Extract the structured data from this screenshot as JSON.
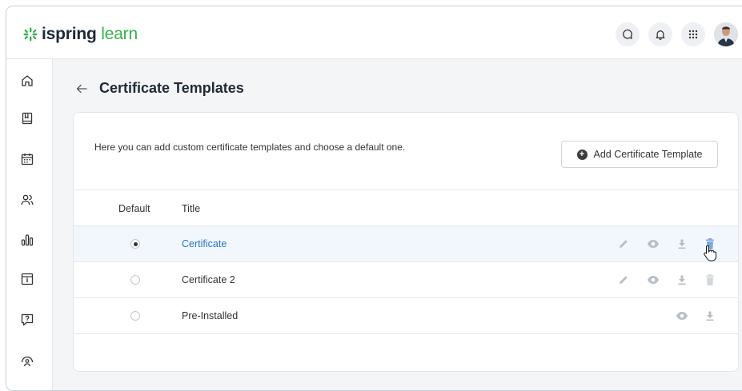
{
  "app": {
    "logo_bold": "ispring",
    "logo_light": " learn",
    "brand_color": "#35b34a"
  },
  "topbar": {
    "icons": [
      "chat-icon",
      "bell-icon",
      "apps-grid-icon"
    ],
    "avatar": "user-avatar"
  },
  "sidebar": {
    "items": [
      {
        "name": "home-icon"
      },
      {
        "name": "book-icon"
      },
      {
        "name": "calendar-icon"
      },
      {
        "name": "people-icon"
      },
      {
        "name": "reports-icon"
      },
      {
        "name": "catalog-icon"
      },
      {
        "name": "help-icon"
      },
      {
        "name": "admin-icon"
      }
    ]
  },
  "page": {
    "title": "Certificate Templates",
    "intro": "Here you can add custom certificate templates and choose a default one.",
    "add_button": "Add Certificate Template"
  },
  "table": {
    "columns": [
      "Default",
      "Title"
    ],
    "rows": [
      {
        "title": "Certificate",
        "default": true,
        "actions": [
          "edit-icon",
          "preview-icon",
          "download-icon",
          "delete-icon"
        ]
      },
      {
        "title": "Certificate 2",
        "default": false,
        "actions": [
          "edit-icon",
          "preview-icon",
          "download-icon",
          "delete-icon"
        ]
      },
      {
        "title": "Pre-Installed",
        "default": false,
        "actions": [
          "preview-icon",
          "download-icon"
        ]
      }
    ]
  },
  "colors": {
    "link": "#2776c7",
    "icon_muted": "#b9bfc7",
    "active_row": "#f2f7fd",
    "delete_hover": "#7aa9df"
  }
}
